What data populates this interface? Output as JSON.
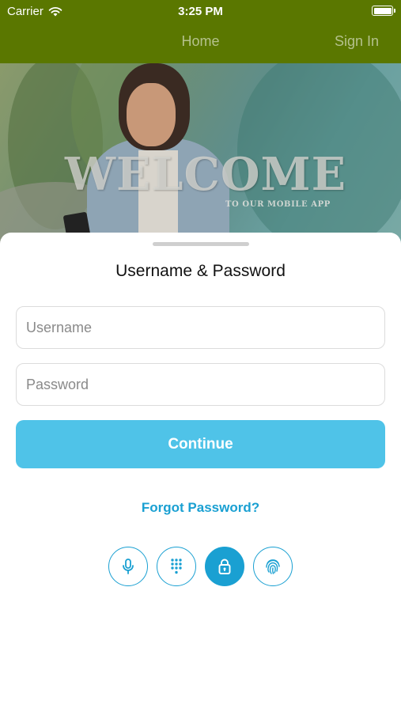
{
  "status_bar": {
    "carrier": "Carrier",
    "time": "3:25 PM"
  },
  "nav": {
    "home": "Home",
    "sign_in": "Sign In"
  },
  "hero": {
    "title": "WELCOME",
    "subtitle": "TO OUR MOBILE APP"
  },
  "login": {
    "title": "Username & Password",
    "username_placeholder": "Username",
    "password_placeholder": "Password",
    "continue_label": "Continue",
    "forgot_label": "Forgot Password?"
  },
  "auth_methods": [
    {
      "icon": "microphone-icon"
    },
    {
      "icon": "keypad-icon"
    },
    {
      "icon": "lock-icon",
      "selected": true
    },
    {
      "icon": "fingerprint-icon"
    }
  ],
  "colors": {
    "nav_bg": "#5a7700",
    "accent": "#1aa0d2",
    "button": "#4fc3e8"
  }
}
